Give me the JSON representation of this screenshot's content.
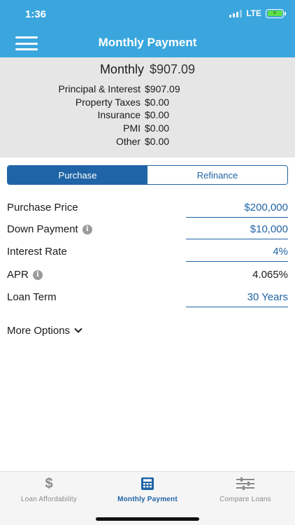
{
  "status": {
    "time": "1:36",
    "network": "LTE"
  },
  "header": {
    "title": "Monthly Payment"
  },
  "summary": {
    "monthly_label": "Monthly",
    "monthly_value": "$907.09",
    "breakdown": [
      {
        "label": "Principal & Interest",
        "value": "$907.09"
      },
      {
        "label": "Property Taxes",
        "value": "$0.00"
      },
      {
        "label": "Insurance",
        "value": "$0.00"
      },
      {
        "label": "PMI",
        "value": "$0.00"
      },
      {
        "label": "Other",
        "value": "$0.00"
      }
    ]
  },
  "segment": {
    "purchase": "Purchase",
    "refinance": "Refinance",
    "selected": "Purchase"
  },
  "form": {
    "purchase_price": {
      "label": "Purchase Price",
      "value": "$200,000"
    },
    "down_payment": {
      "label": "Down Payment",
      "value": "$10,000"
    },
    "interest_rate": {
      "label": "Interest Rate",
      "value": "4%"
    },
    "apr": {
      "label": "APR",
      "value": "4.065%"
    },
    "loan_term": {
      "label": "Loan Term",
      "value": "30 Years"
    }
  },
  "more_options": "More Options",
  "tabs": [
    {
      "label": "Loan Affordability",
      "icon": "dollar-icon"
    },
    {
      "label": "Monthly Payment",
      "icon": "calculator-icon"
    },
    {
      "label": "Compare Loans",
      "icon": "sliders-icon"
    }
  ],
  "colors": {
    "header": "#3aa6dd",
    "accent": "#1f64a6",
    "summary_bg": "#e6e6e6"
  }
}
